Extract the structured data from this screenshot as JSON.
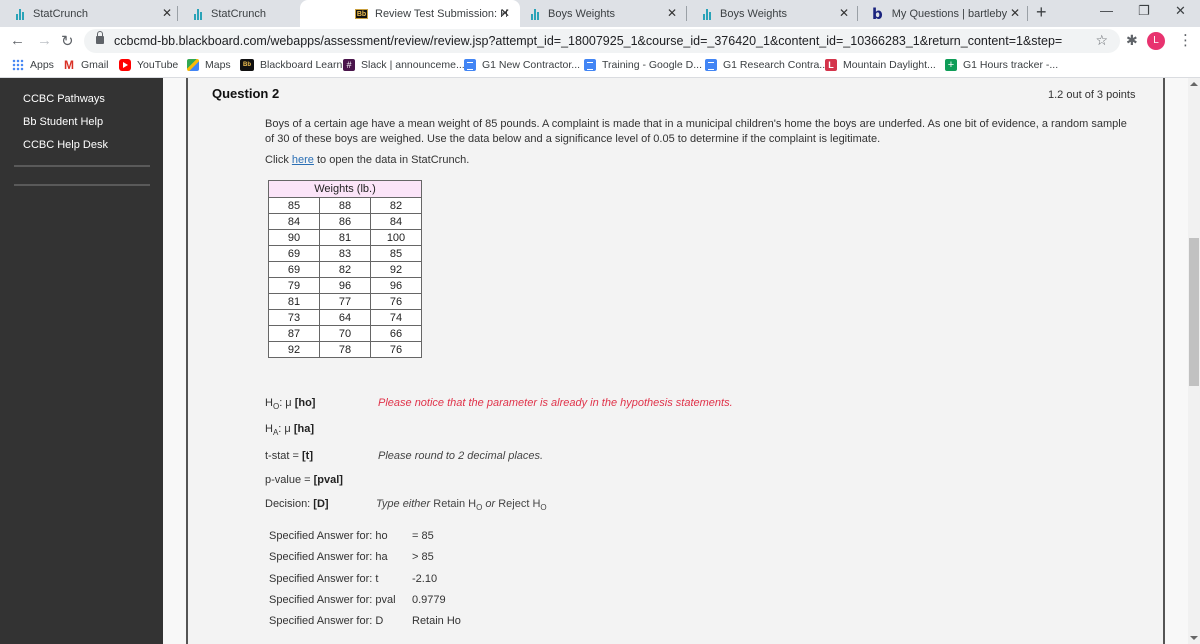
{
  "browser": {
    "tabs": [
      {
        "title": "StatCrunch",
        "icon": "statcrunch-icon",
        "active": false
      },
      {
        "title": "StatCrunch",
        "icon": "statcrunch-icon",
        "active": false
      },
      {
        "title": "Review Test Submission: Hon",
        "icon": "blackboard-icon",
        "active": true
      },
      {
        "title": "Boys Weights",
        "icon": "statcrunch-icon",
        "active": false
      },
      {
        "title": "Boys Weights",
        "icon": "statcrunch-icon",
        "active": false
      },
      {
        "title": "My Questions | bartleby",
        "icon": "bartleby-icon",
        "active": false
      }
    ],
    "close_glyph": "✕",
    "new_tab_glyph": "+",
    "window_controls": {
      "minimize": "—",
      "restore": "❐",
      "close": "✕"
    },
    "url": "ccbcmd-bb.blackboard.com/webapps/assessment/review/review.jsp?attempt_id=_18007925_1&course_id=_376420_1&content_id=_10366283_1&return_content=1&step=",
    "profile_initial": "L",
    "profile_color": "#e8336f",
    "bookmarks": [
      {
        "label": "Apps",
        "icon": "apps-icon"
      },
      {
        "label": "Gmail",
        "icon": "gmail-icon"
      },
      {
        "label": "YouTube",
        "icon": "youtube-icon"
      },
      {
        "label": "Maps",
        "icon": "maps-icon"
      },
      {
        "label": "Blackboard Learn",
        "icon": "blackboard-icon"
      },
      {
        "label": "Slack | announceme...",
        "icon": "slack-icon"
      },
      {
        "label": "G1 New Contractor...",
        "icon": "google-docs-icon"
      },
      {
        "label": "Training - Google D...",
        "icon": "google-docs-icon"
      },
      {
        "label": "G1 Research Contra...",
        "icon": "google-docs-icon"
      },
      {
        "label": "Mountain Daylight...",
        "icon": "calendar-icon"
      },
      {
        "label": "G1 Hours tracker -...",
        "icon": "google-sheets-icon"
      }
    ]
  },
  "sidebar": {
    "items": [
      "CCBC Pathways",
      "Bb Student Help",
      "CCBC Help Desk"
    ]
  },
  "question": {
    "title": "Question 2",
    "points": "1.2 out of 3 points",
    "text": "Boys of a certain age have a mean weight of 85 pounds. A complaint is made that in a municipal children's home the boys are underfed. As one bit of evidence, a random sample of 30 of these boys are weighed.  Use the data below and a significance level of 0.05 to determine if the complaint is legitimate.",
    "click_prefix": "Click ",
    "click_link": "here",
    "click_suffix": " to open the data in StatCrunch.",
    "table": {
      "header": "Weights (lb.)",
      "rows": [
        [
          "85",
          "88",
          "82"
        ],
        [
          "84",
          "86",
          "84"
        ],
        [
          "90",
          "81",
          "100"
        ],
        [
          "69",
          "83",
          "85"
        ],
        [
          "69",
          "82",
          "92"
        ],
        [
          "79",
          "96",
          "96"
        ],
        [
          "81",
          "77",
          "76"
        ],
        [
          "73",
          "64",
          "74"
        ],
        [
          "87",
          "70",
          "66"
        ],
        [
          "92",
          "78",
          "76"
        ]
      ]
    },
    "hypotheses": {
      "h0_prefix": "H",
      "h0_sub": "O",
      "h0_mid": ": μ ",
      "h0_blank": "[ho]",
      "ha_prefix": "H",
      "ha_sub": "A",
      "ha_mid": ": μ ",
      "ha_blank": "[ha]",
      "t_label": "t-stat = ",
      "t_blank": "[t]",
      "p_label": "p-value = ",
      "p_blank": "[pval]",
      "d_label": "Decision: ",
      "d_blank": "[D]"
    },
    "notes": {
      "parameter": "Please notice that the parameter is already in the hypothesis statements.",
      "rounding": "Please round to 2 decimal places.",
      "decision_a": "Type either ",
      "decision_b": "Retain H",
      "decision_sub1": "O",
      "decision_c": " or ",
      "decision_d": "Reject H",
      "decision_sub2": "O"
    },
    "answers": [
      {
        "label": "Specified Answer for: ho",
        "value": "= 85"
      },
      {
        "label": "Specified Answer for: ha",
        "value": "> 85"
      },
      {
        "label": "Specified Answer for: t",
        "value": "-2.10"
      },
      {
        "label": "Specified Answer for: pval",
        "value": "0.9779"
      },
      {
        "label": "Specified Answer for: D",
        "value": "Retain Ho"
      }
    ]
  }
}
